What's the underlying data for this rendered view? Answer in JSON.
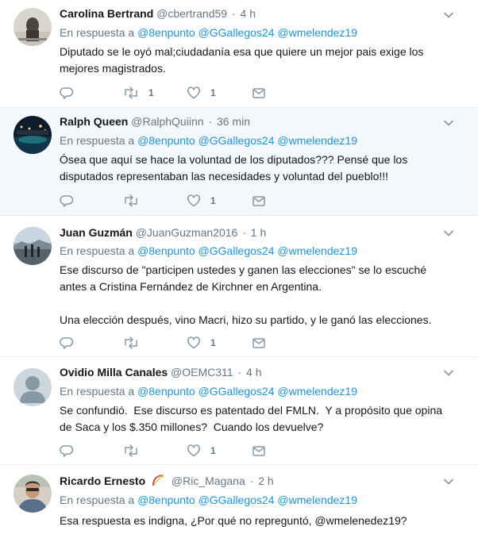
{
  "reply_prefix": "En respuesta a",
  "tweets": [
    {
      "name": "Carolina Bertrand",
      "handle": "@cbertrand59",
      "time": "4 h",
      "mentions": [
        "@8enpunto",
        "@GGallegos24",
        "@wmelendez19"
      ],
      "text": "Diputado se le oyó mal;ciudadanía esa que quiere un mejor pais exige los\nmejores magistrados.",
      "replies": "",
      "retweets": "1",
      "likes": "1"
    },
    {
      "name": "Ralph Queen",
      "handle": "@RalphQuiinn",
      "time": "36 min",
      "mentions": [
        "@8enpunto",
        "@GGallegos24",
        "@wmelendez19"
      ],
      "text": "Ósea que aquí se hace la voluntad de los diputados??? Pensé que los\ndisputados representaban las necesidades y voluntad del pueblo!!!",
      "replies": "",
      "retweets": "",
      "likes": "1"
    },
    {
      "name": "Juan Guzmán",
      "handle": "@JuanGuzman2016",
      "time": "1 h",
      "mentions": [
        "@8enpunto",
        "@GGallegos24",
        "@wmelendez19"
      ],
      "text": "Ese discurso de \"participen ustedes y ganen las elecciones\" se lo escuché\nantes a Cristina Fernández de Kirchner en Argentina.\n\nUna elección después, vino Macri, hizo su partido, y le ganó las elecciones.",
      "replies": "",
      "retweets": "",
      "likes": "1"
    },
    {
      "name": "Ovidio Milla Canales",
      "handle": "@OEMC311",
      "time": "4 h",
      "mentions": [
        "@8enpunto",
        "@GGallegos24",
        "@wmelendez19"
      ],
      "text": "Se confundió.  Ese discurso es patentado del FMLN.  Y a propósito que opina\nde Saca y los $.350 millones?  Cuando los devuelve?",
      "replies": "",
      "retweets": "",
      "likes": "1"
    },
    {
      "name": "Ricardo Ernesto",
      "handle": "@Ric_Magana",
      "time": "2 h",
      "mentions": [
        "@8enpunto",
        "@GGallegos24",
        "@wmelendez19"
      ],
      "text": "Esa respuesta es indigna, ¿Por qué no repreguntó, @wmelenedez19?",
      "replies": "",
      "retweets": "",
      "likes": ""
    }
  ],
  "colors": {
    "link": "#1b95e0",
    "secondary": "#657786",
    "text": "#14171a",
    "highlight_bg": "#f5f8fa",
    "border": "#e6ecf0"
  },
  "icons": [
    "reply-icon",
    "retweet-icon",
    "like-icon",
    "dm-icon",
    "chevron-down-icon",
    "bow-arrow-badge-icon"
  ]
}
